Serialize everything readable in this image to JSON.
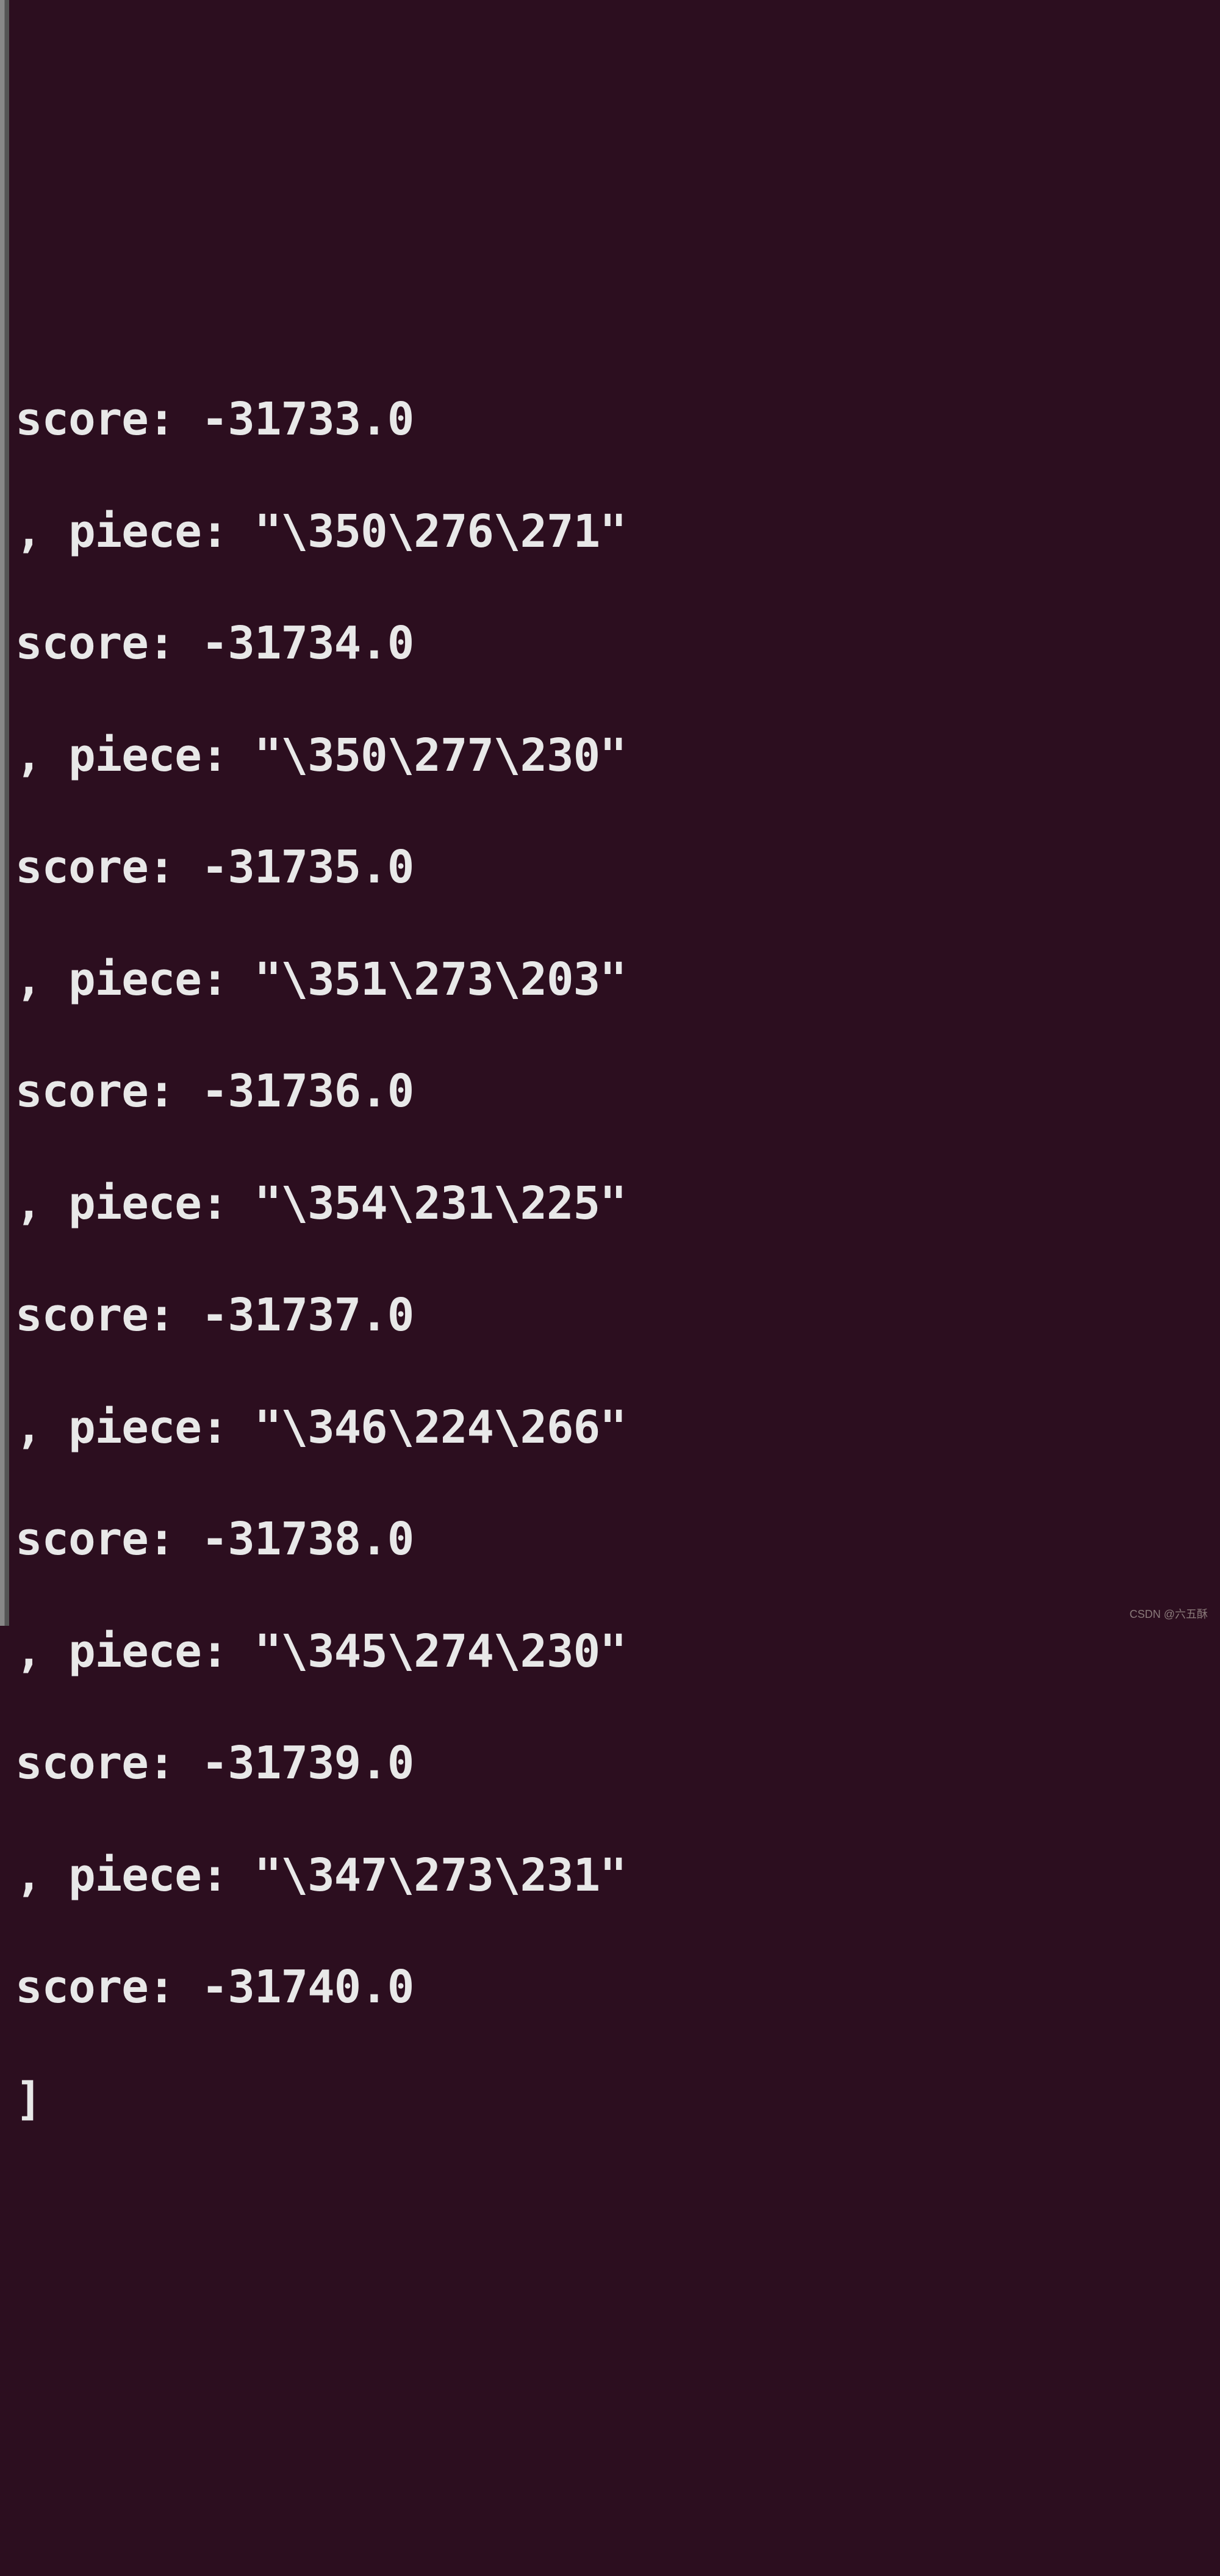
{
  "terminal": {
    "lines": [
      "score: -31733.0",
      ", piece: \"\\350\\276\\271\"",
      "score: -31734.0",
      ", piece: \"\\350\\277\\230\"",
      "score: -31735.0",
      ", piece: \"\\351\\273\\203\"",
      "score: -31736.0",
      ", piece: \"\\354\\231\\225\"",
      "score: -31737.0",
      ", piece: \"\\346\\224\\266\"",
      "score: -31738.0",
      ", piece: \"\\345\\274\\230\"",
      "score: -31739.0",
      ", piece: \"\\347\\273\\231\"",
      "score: -31740.0",
      "]"
    ]
  },
  "watermark": "CSDN @六五酥"
}
